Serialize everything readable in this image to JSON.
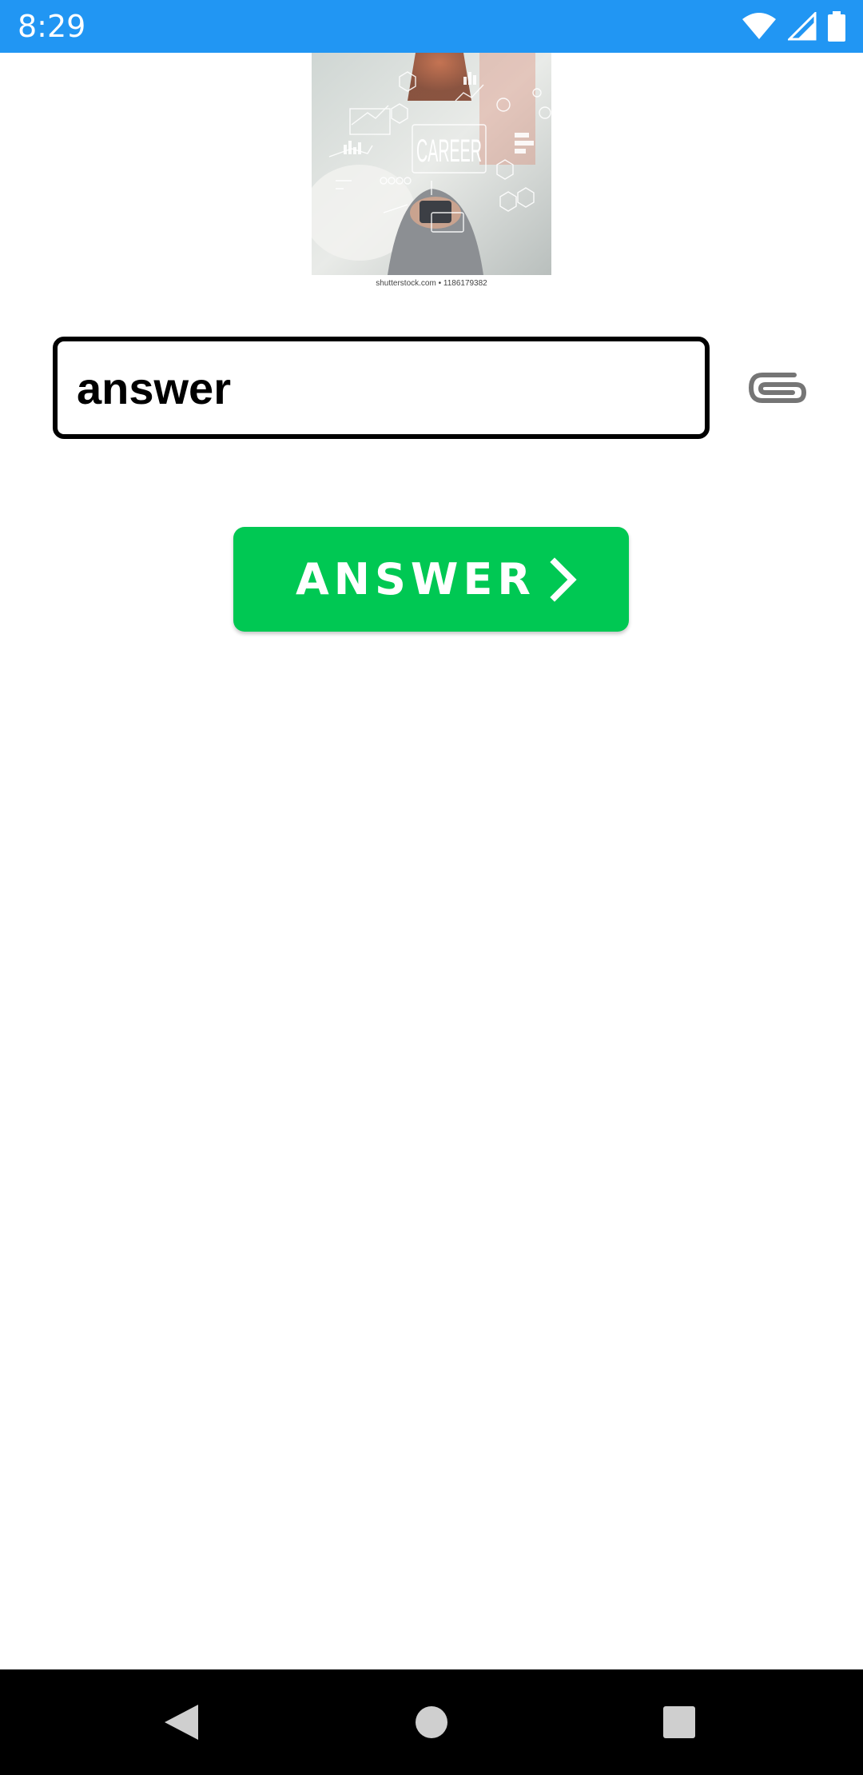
{
  "status_bar": {
    "time": "8:29",
    "color": "#2196F3",
    "icons": [
      "wifi-icon",
      "cellular-signal-icon",
      "battery-icon"
    ]
  },
  "hero_image": {
    "overlay_text": "CAREER",
    "caption": "shutterstock.com • 1186179382"
  },
  "answer_input": {
    "value": "answer",
    "placeholder": ""
  },
  "attach_button": {
    "icon": "paperclip-icon"
  },
  "answer_button": {
    "label": "ANSWER",
    "icon": "chevron-right-icon",
    "color": "#00C853"
  },
  "nav_bar": {
    "items": [
      "back-icon",
      "home-icon",
      "recents-icon"
    ]
  }
}
